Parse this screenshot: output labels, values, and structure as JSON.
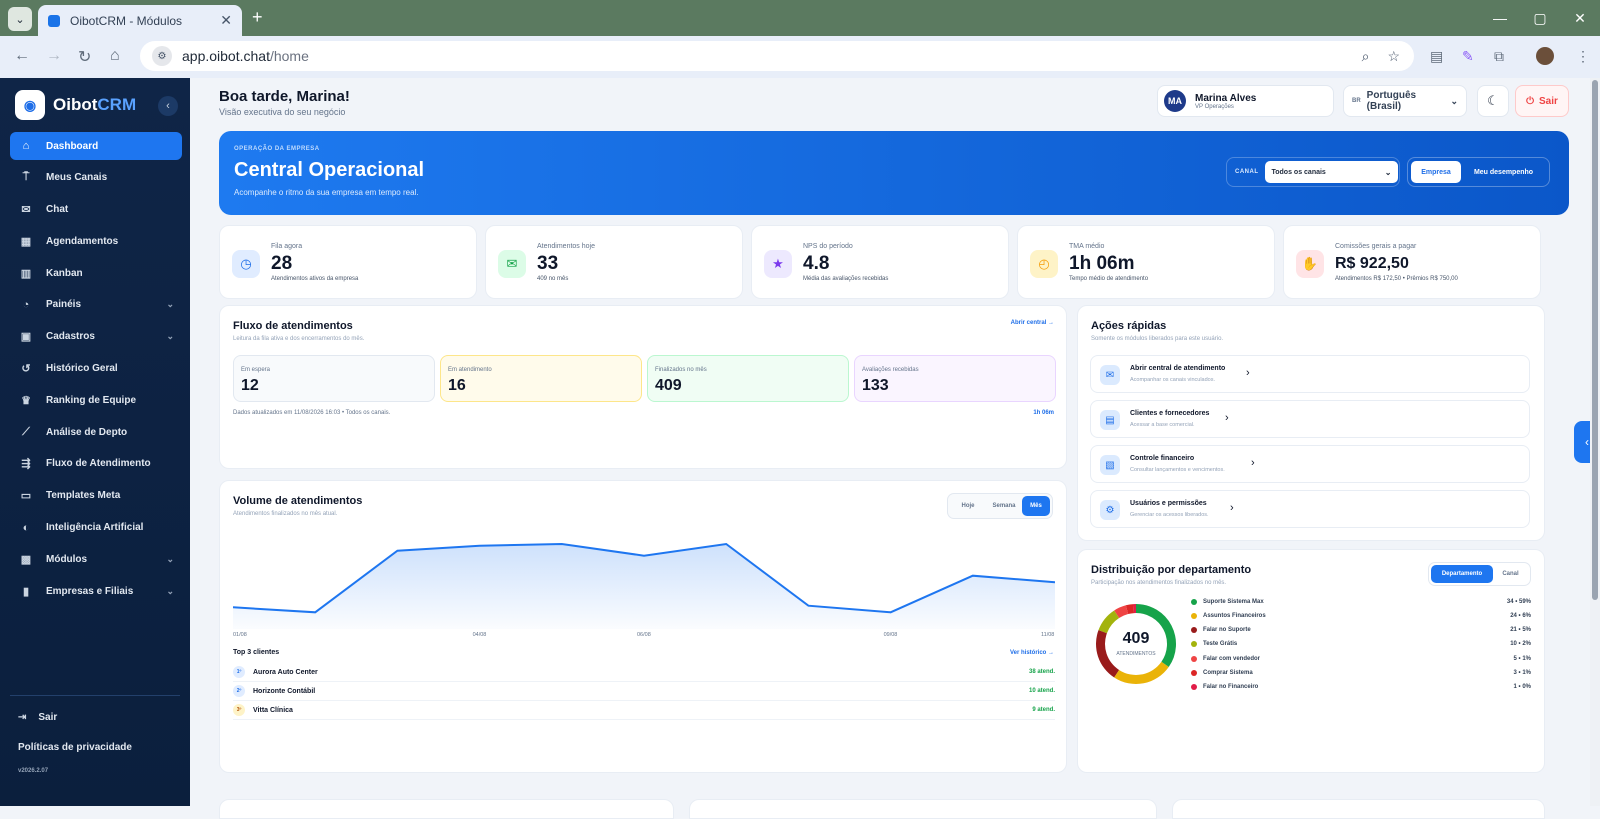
{
  "browser": {
    "tab_title": "OibotCRM - Módulos",
    "url_host": "app.oibot.chat",
    "url_path": "/home"
  },
  "sidebar": {
    "logo_main": "Oibot",
    "logo_accent": "CRM",
    "items": [
      {
        "label": "Dashboard",
        "icon": "home-icon",
        "active": true
      },
      {
        "label": "Meus Canais",
        "icon": "antenna-icon"
      },
      {
        "label": "Chat",
        "icon": "chat-icon"
      },
      {
        "label": "Agendamentos",
        "icon": "calendar-icon"
      },
      {
        "label": "Kanban",
        "icon": "kanban-icon"
      },
      {
        "label": "Painéis",
        "icon": "pie-chart-icon",
        "expandable": true
      },
      {
        "label": "Cadastros",
        "icon": "id-card-icon",
        "expandable": true
      },
      {
        "label": "Histórico Geral",
        "icon": "history-icon"
      },
      {
        "label": "Ranking de Equipe",
        "icon": "trophy-icon"
      },
      {
        "label": "Análise de Depto",
        "icon": "line-chart-icon"
      },
      {
        "label": "Fluxo de Atendimento",
        "icon": "flow-icon"
      },
      {
        "label": "Templates Meta",
        "icon": "message-icon"
      },
      {
        "label": "Inteligência Artificial",
        "icon": "brain-icon"
      },
      {
        "label": "Módulos",
        "icon": "cubes-icon",
        "expandable": true
      },
      {
        "label": "Empresas e Filiais",
        "icon": "building-icon",
        "expandable": true
      }
    ],
    "logout_label": "Sair",
    "privacy_label": "Políticas de privacidade",
    "version": "v2026.2.07"
  },
  "header": {
    "greeting": "Boa tarde, Marina!",
    "subtitle": "Visão executiva do seu negócio",
    "user_initials": "MA",
    "user_name": "Marina Alves",
    "user_role": "VP Operações",
    "lang_flag": "BR",
    "language": "Português (Brasil)",
    "logout_label": "Sair"
  },
  "hero": {
    "eyebrow": "OPERAÇÃO DA EMPRESA",
    "title": "Central Operacional",
    "subtitle": "Acompanhe o ritmo da sua empresa em tempo real.",
    "canal_label": "CANAL",
    "canal_value": "Todos os canais",
    "toggle_on": "Empresa",
    "toggle_off": "Meu desempenho"
  },
  "kpis": [
    {
      "label": "Fila agora",
      "value": "28",
      "hint": "Atendimentos ativos da empresa",
      "icon": "clock-icon",
      "color": "#1e6ee8",
      "bg": "#e0ecff"
    },
    {
      "label": "Atendimentos hoje",
      "value": "33",
      "hint": "409 no mês",
      "icon": "chat-bubbles-icon",
      "color": "#16a34a",
      "bg": "#dcfce7"
    },
    {
      "label": "NPS do período",
      "value": "4.8",
      "hint": "Média das avaliações recebidas",
      "icon": "star-icon",
      "color": "#7c3aed",
      "bg": "#ede9fe"
    },
    {
      "label": "TMA médio",
      "value": "1h 06m",
      "hint": "Tempo médio de atendimento",
      "icon": "stopwatch-icon",
      "color": "#f59e0b",
      "bg": "#fef3c7"
    },
    {
      "label": "Comissões gerais a pagar",
      "value": "R$ 922,50",
      "hint": "Atendimentos R$ 172,50 • Prêmios R$ 750,00",
      "icon": "money-hand-icon",
      "color": "#e11d48",
      "bg": "#ffe4e6"
    }
  ],
  "flow": {
    "title": "Fluxo de atendimentos",
    "subtitle": "Leitura da fila ativa e dos encerramentos do mês.",
    "link": "Abrir central →",
    "stats": [
      {
        "label": "Em espera",
        "value": "12"
      },
      {
        "label": "Em atendimento",
        "value": "16"
      },
      {
        "label": "Finalizados no mês",
        "value": "409"
      },
      {
        "label": "Avaliações recebidas",
        "value": "133"
      }
    ],
    "updated": "Dados atualizados em 11/08/2026 16:03 • Todos os canais.",
    "tma": "1h 06m"
  },
  "quick": {
    "title": "Ações rápidas",
    "subtitle": "Somente os módulos liberados para este usuário.",
    "items": [
      {
        "title": "Abrir central de atendimento",
        "sub": "Acompanhar os canais vinculados.",
        "icon": "chat-bubbles-icon"
      },
      {
        "title": "Clientes e fornecedores",
        "sub": "Acessar a base comercial.",
        "icon": "contact-card-icon"
      },
      {
        "title": "Controle financeiro",
        "sub": "Consultar lançamentos e vencimentos.",
        "icon": "invoice-icon"
      },
      {
        "title": "Usuários e permissões",
        "sub": "Gerenciar os acessos liberados.",
        "icon": "user-gear-icon"
      }
    ]
  },
  "volume": {
    "title": "Volume de atendimentos",
    "subtitle": "Atendimentos finalizados no mês atual.",
    "ranges": [
      "Hoje",
      "Semana",
      "Mês"
    ],
    "active_range": "Mês",
    "top_title": "Top 3 clientes",
    "top_link": "Ver histórico →",
    "clients": [
      {
        "rank": "1º",
        "name": "Aurora Auto Center",
        "count": "38 atend.",
        "bg": "#e0ecff",
        "color": "#1e6ee8"
      },
      {
        "rank": "2º",
        "name": "Horizonte Contábil",
        "count": "10 atend.",
        "bg": "#e0ecff",
        "color": "#1e6ee8"
      },
      {
        "rank": "3º",
        "name": "Vitta Clínica",
        "count": "9 atend.",
        "bg": "#fef3c7",
        "color": "#b45309"
      }
    ]
  },
  "chart_data": [
    {
      "type": "area",
      "title": "Volume de atendimentos",
      "x": [
        "01/08",
        "02/08",
        "03/08",
        "04/08",
        "05/08",
        "06/08",
        "07/08",
        "08/08",
        "09/08",
        "10/08",
        "11/08"
      ],
      "x_tick_labels": [
        "01/08",
        "04/08",
        "06/08",
        "09/08",
        "11/08"
      ],
      "series": [
        {
          "values": [
            13,
            10,
            47,
            50,
            51,
            44,
            51,
            14,
            10,
            32,
            28
          ]
        }
      ],
      "ylim": [
        0,
        60
      ],
      "grid": false,
      "color": "#1e76f0"
    },
    {
      "type": "pie",
      "title": "Distribuição por departamento",
      "subtitle": "Participação nos atendimentos finalizados no mês.",
      "center_value": "409",
      "center_label": "ATENDIMENTOS",
      "tabs": [
        "Departamento",
        "Canal"
      ],
      "slices": [
        {
          "name": "Suporte Sistema Max",
          "value": 34,
          "pct": "59%",
          "display": "34 • 59%",
          "color": "#16a34a"
        },
        {
          "name": "Assuntos Financeiros",
          "value": 24,
          "pct": "6%",
          "display": "24 • 6%",
          "color": "#eab308"
        },
        {
          "name": "Falar no Suporte",
          "value": 21,
          "pct": "5%",
          "display": "21 • 5%",
          "color": "#991b1b"
        },
        {
          "name": "Teste Grátis",
          "value": 10,
          "pct": "2%",
          "display": "10 • 2%",
          "color": "#a3b30c"
        },
        {
          "name": "Falar com vendedor",
          "value": 5,
          "pct": "1%",
          "display": "5 • 1%",
          "color": "#ef4444"
        },
        {
          "name": "Comprar Sistema",
          "value": 3,
          "pct": "1%",
          "display": "3 • 1%",
          "color": "#dc2626"
        },
        {
          "name": "Falar no Financeiro",
          "value": 1,
          "pct": "0%",
          "display": "1 • 0%",
          "color": "#e11d48"
        }
      ]
    }
  ]
}
